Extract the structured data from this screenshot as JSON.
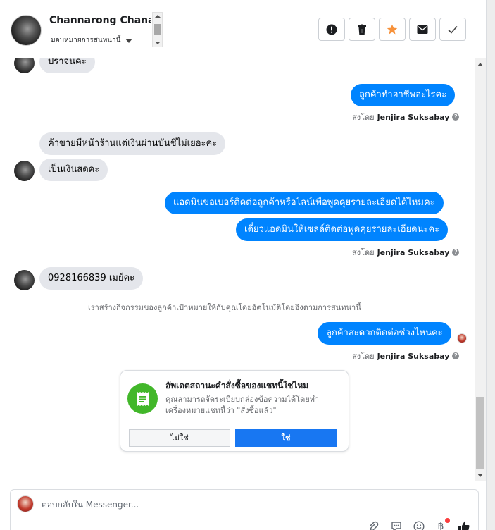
{
  "header": {
    "contact_name": "Channarong Chanarok",
    "assign_label": "มอบหมายการสนทนานี้",
    "actions": [
      {
        "icon": "exclamation-icon",
        "label": "spam"
      },
      {
        "icon": "trash-icon",
        "label": "delete"
      },
      {
        "icon": "star-icon",
        "label": "follow up"
      },
      {
        "icon": "envelope-icon",
        "label": "mark unread"
      },
      {
        "icon": "check-icon",
        "label": "done"
      }
    ]
  },
  "messages": {
    "m1": "ปราจนคะ",
    "m2": "ลูกค้าทำอาชีพอะไรคะ",
    "m3": "ค้าขายมีหน้าร้านแต่เงินผ่านบันชีไม่เยอะคะ",
    "m4": "เป็นเงินสดคะ",
    "m5": "แอดมินขอเบอร์ติดต่อลูกค้าหรือไลน์เพื่อพูดคุยรายละเอียดได้ไหมคะ",
    "m6": "เดี๋ยวแอดมินให้เซลล์ติดต่อพูดคุยรายละเอียดนะคะ",
    "m7": "0928166839 เมย์คะ",
    "m8": "ลูกค้าสะดวกติดต่อช่วงไหนคะ"
  },
  "sent_by": {
    "prefix": "ส่งโดย",
    "name": "Jenjira Suksabay",
    "help": "?"
  },
  "system_note": "เราสร้างกิจกรรมของลูกค้าเป้าหมายให้กับคุณโดยอัตโนมัติโดยอิงตามการสนทนานี้",
  "card": {
    "title": "อัพเดตสถานะคำสั่งซื้อของแชทนี้ใช่ไหม",
    "body": "คุณสามารถจัดระเบียบกล่องข้อความได้โดยทำเครื่องหมายแชทนี้ว่า \"สั่งซื้อแล้ว\"",
    "no_label": "ไม่ใช่",
    "yes_label": "ใช่"
  },
  "composer": {
    "placeholder": "ตอบกลับใน Messenger...",
    "currency_symbol": "฿"
  },
  "colors": {
    "outgoing_bubble": "#0084ff",
    "incoming_bubble": "#e4e6eb",
    "star": "#f7923b",
    "primary_button": "#1877f2",
    "card_icon": "#42b72a"
  }
}
